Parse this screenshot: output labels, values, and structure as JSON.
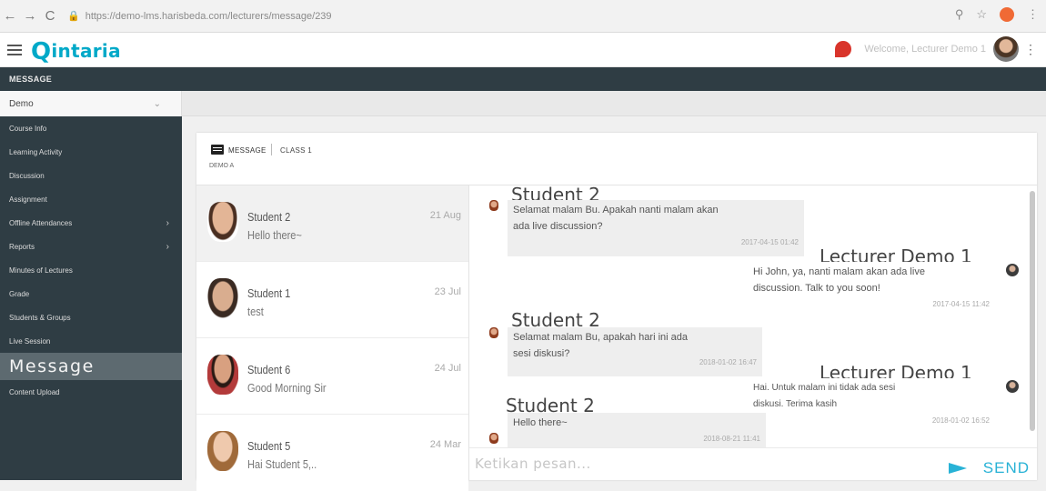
{
  "browser": {
    "url": "https://demo-lms.harisbeda.com/lecturers/message/239",
    "back_icon": "arrow-left",
    "forward_icon": "arrow-right",
    "reload_icon": "reload"
  },
  "header": {
    "logo_text": "intaria",
    "logo_letter": "Q",
    "welcome_text": "Welcome, Lecturer Demo 1"
  },
  "section": {
    "title": "MESSAGE"
  },
  "course": {
    "selected": "Demo",
    "caret": "⌄"
  },
  "sidebar": {
    "items": [
      {
        "label": "Course Info"
      },
      {
        "label": "Learning Activity"
      },
      {
        "label": "Discussion"
      },
      {
        "label": "Assignment"
      },
      {
        "label": "Offline Attendances",
        "arrow": "›"
      },
      {
        "label": "Reports",
        "arrow": "›"
      },
      {
        "label": "Minutes of Lectures"
      },
      {
        "label": "Grade"
      },
      {
        "label": "Students & Groups"
      },
      {
        "label": "Live Session"
      },
      {
        "label": "Message"
      },
      {
        "label": "Content Upload"
      }
    ]
  },
  "panel": {
    "title": "MESSAGE",
    "class_label": "CLASS 1",
    "subtitle": "DEMO A"
  },
  "contacts": [
    {
      "name": "Student 2",
      "message": "Hello there~",
      "date": "21 Aug",
      "avatar_color": "#c98a6a"
    },
    {
      "name": "Student 1",
      "message": "test",
      "date": "23 Jul",
      "avatar_color": "#b88a6f"
    },
    {
      "name": "Student 6",
      "message": "Good Morning Sir",
      "date": "24 Jul",
      "avatar_color": "#9e5a40"
    },
    {
      "name": "Student 5",
      "message": "Hai Student 5,..",
      "date": "24 Mar",
      "avatar_color": "#c6a58a"
    }
  ],
  "chat": {
    "messages": [
      {
        "sender": "Student 2",
        "text_line1": "Selamat malam Bu. Apakah nanti malam akan",
        "text_line2": "ada live discussion?",
        "time": "2017-04-15 01:42"
      },
      {
        "sender": "Lecturer Demo 1",
        "text_line1": "Hi John, ya, nanti malam akan ada live",
        "text_line2": "discussion. Talk to you soon!",
        "time": "2017-04-15 11:42"
      },
      {
        "sender": "Student 2",
        "text_line1": "Selamat malam Bu, apakah hari ini ada",
        "text_line2": "sesi diskusi?",
        "time": "2018-01-02 16:47"
      },
      {
        "sender": "Lecturer Demo 1",
        "text_line1": "Hai. Untuk malam ini tidak ada sesi",
        "text_line2": "diskusi. Terima kasih",
        "time": "2018-01-02 16:52"
      },
      {
        "sender": "Student 2",
        "text_line1": "Hello there~",
        "text_line2": "",
        "time": "2018-08-21 11:41"
      }
    ],
    "input_placeholder": "Ketikan pesan...",
    "send_label": "SEND"
  },
  "colors": {
    "accent": "#28b2d6",
    "sidebar": "#2f3d44",
    "logo": "#00a9c8"
  }
}
